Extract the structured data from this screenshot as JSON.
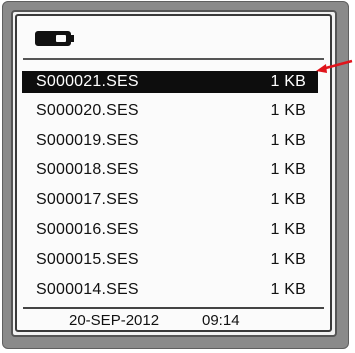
{
  "status": {
    "battery_icon": "battery-icon"
  },
  "files": [
    {
      "name": "S000021.SES",
      "size": "1 KB",
      "selected": true
    },
    {
      "name": "S000020.SES",
      "size": "1 KB",
      "selected": false
    },
    {
      "name": "S000019.SES",
      "size": "1 KB",
      "selected": false
    },
    {
      "name": "S000018.SES",
      "size": "1 KB",
      "selected": false
    },
    {
      "name": "S000017.SES",
      "size": "1 KB",
      "selected": false
    },
    {
      "name": "S000016.SES",
      "size": "1 KB",
      "selected": false
    },
    {
      "name": "S000015.SES",
      "size": "1 KB",
      "selected": false
    },
    {
      "name": "S000014.SES",
      "size": "1 KB",
      "selected": false
    }
  ],
  "footer": {
    "date": "20-SEP-2012",
    "time": "09:14"
  },
  "colors": {
    "selection_bg": "#0d0d0d",
    "pointer": "#e0141b"
  }
}
